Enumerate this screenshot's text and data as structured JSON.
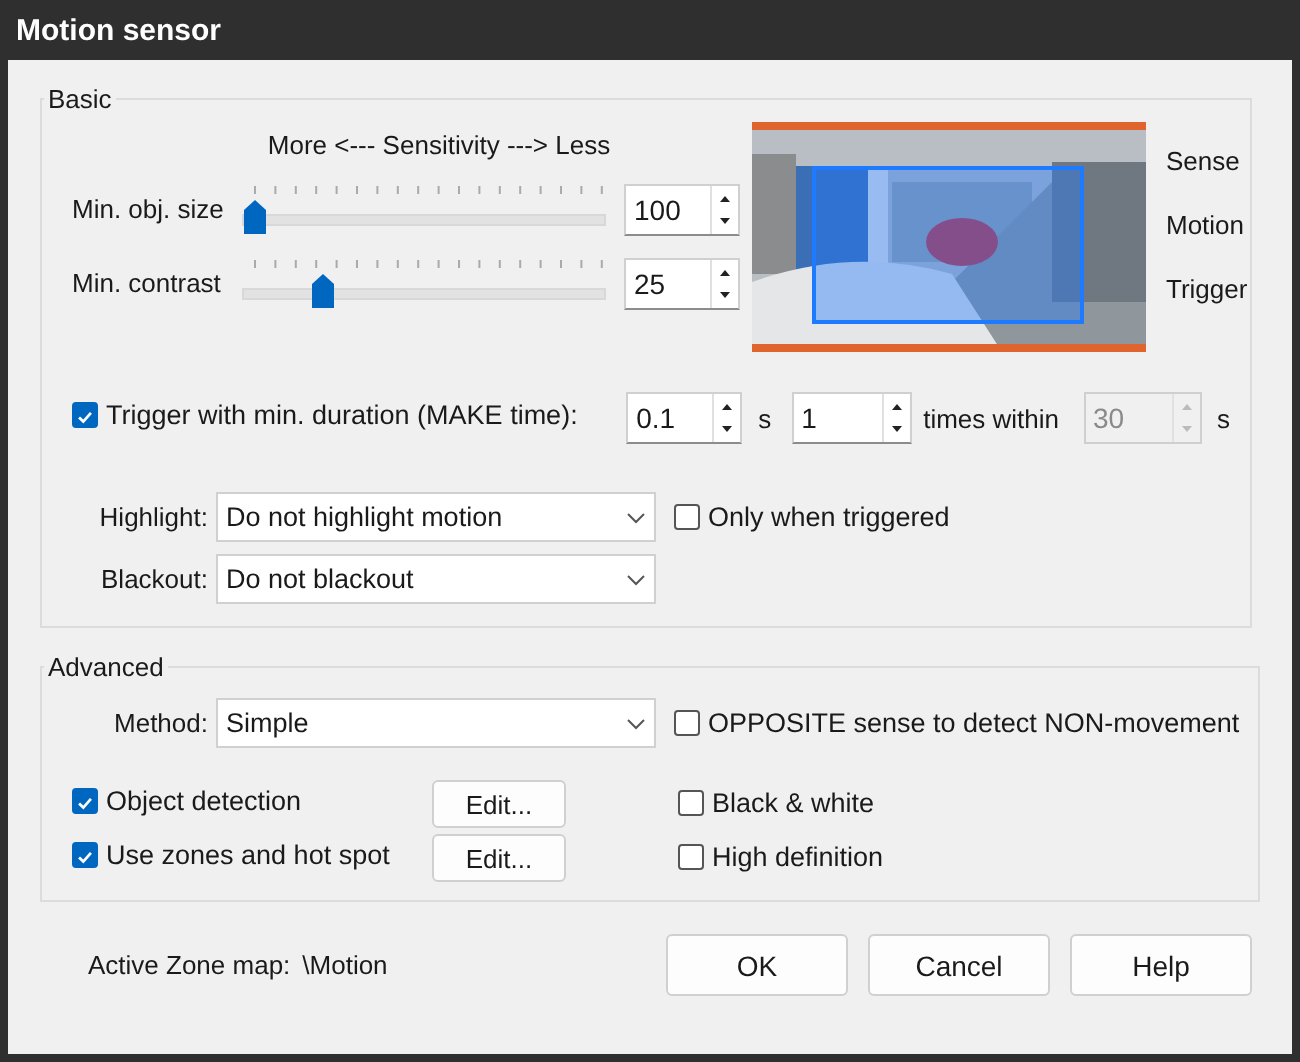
{
  "window": {
    "title": "Motion sensor"
  },
  "basic": {
    "title": "Basic",
    "sensitivity_caption": "More <--- Sensitivity ---> Less",
    "sliders": [
      {
        "label": "Min. obj. size",
        "level": 0,
        "value": "100"
      },
      {
        "label": "Min. contrast",
        "level": 0.2,
        "value": "25"
      }
    ],
    "preview_labels": [
      "Sense",
      "Motion",
      "Trigger"
    ],
    "trigger": {
      "label": "Trigger with min. duration (MAKE time):",
      "checked": true,
      "duration": "0.1",
      "duration_unit": "s",
      "count": "1",
      "count_label": "times within",
      "within": "30",
      "within_disabled": true,
      "within_unit": "s"
    },
    "highlight": {
      "label": "Highlight:",
      "value": "Do not highlight motion",
      "option": {
        "label": "Only when triggered",
        "checked": false
      }
    },
    "blackout": {
      "label": "Blackout:",
      "value": "Do not blackout"
    }
  },
  "advanced": {
    "title": "Advanced",
    "method": {
      "label": "Method:",
      "value": "Simple"
    },
    "opposite": {
      "label": "OPPOSITE sense to detect NON-movement",
      "checked": false
    },
    "options": [
      {
        "label": "Object detection",
        "checked": true,
        "button": "Edit...",
        "side": {
          "label": "Black & white",
          "checked": false
        }
      },
      {
        "label": "Use zones and hot spot",
        "checked": true,
        "button": "Edit...",
        "side": {
          "label": "High definition",
          "checked": false
        }
      }
    ]
  },
  "footer": {
    "zone_map_label": "Active Zone map:",
    "zone_map_value": "\\Motion",
    "buttons": [
      "OK",
      "Cancel",
      "Help"
    ]
  }
}
